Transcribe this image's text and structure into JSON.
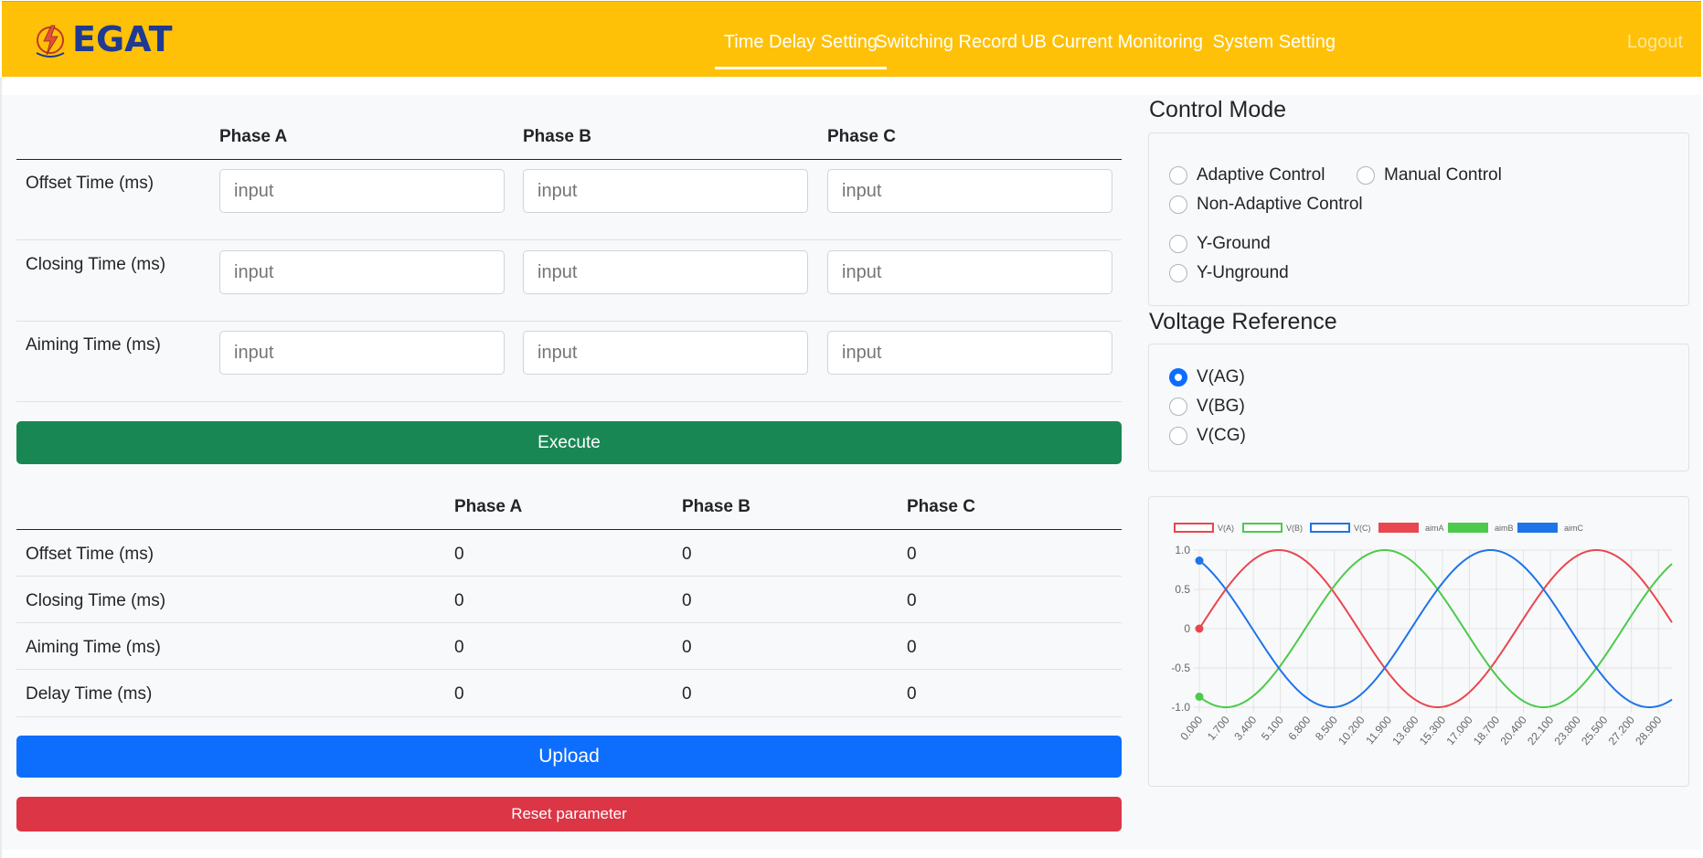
{
  "brand": {
    "name": "EGAT"
  },
  "nav": {
    "items": [
      {
        "label": "Time Delay Setting"
      },
      {
        "label": "Switching Record"
      },
      {
        "label": "UB Current Monitoring"
      },
      {
        "label": "System Setting"
      },
      {
        "label": "Logout"
      }
    ]
  },
  "settings_table": {
    "headers": [
      "Phase A",
      "Phase B",
      "Phase C"
    ],
    "rows": [
      {
        "label": "Offset Time (ms)",
        "placeholder": "input"
      },
      {
        "label": "Closing Time (ms)",
        "placeholder": "input"
      },
      {
        "label": "Aiming Time (ms)",
        "placeholder": "input"
      }
    ],
    "execute_label": "Execute"
  },
  "results_table": {
    "headers": [
      "Phase A",
      "Phase B",
      "Phase C"
    ],
    "rows": [
      {
        "label": "Offset Time (ms)",
        "values": [
          "0",
          "0",
          "0"
        ]
      },
      {
        "label": "Closing Time (ms)",
        "values": [
          "0",
          "0",
          "0"
        ]
      },
      {
        "label": "Aiming Time (ms)",
        "values": [
          "0",
          "0",
          "0"
        ]
      },
      {
        "label": "Delay Time (ms)",
        "values": [
          "0",
          "0",
          "0"
        ]
      }
    ],
    "upload_label": "Upload",
    "reset_label": "Reset parameter"
  },
  "control_mode": {
    "title": "Control Mode",
    "options": [
      {
        "label": "Adaptive Control",
        "checked": false
      },
      {
        "label": "Manual Control",
        "checked": false
      },
      {
        "label": "Non-Adaptive Control",
        "checked": false
      },
      {
        "label": "Y-Ground",
        "checked": false
      },
      {
        "label": "Y-Unground",
        "checked": false
      }
    ]
  },
  "voltage_reference": {
    "title": "Voltage Reference",
    "options": [
      {
        "label": "V(AG)",
        "checked": true
      },
      {
        "label": "V(BG)",
        "checked": false
      },
      {
        "label": "V(CG)",
        "checked": false
      }
    ]
  },
  "colors": {
    "navbar": "#ffc107",
    "success": "#198754",
    "primary": "#0d6efd",
    "danger": "#dc3545",
    "phaseA": "#e8474f",
    "phaseB": "#4cca4c",
    "phaseC": "#1f74e8"
  },
  "chart_data": {
    "type": "line",
    "legend": [
      "V(A)",
      "V(B)",
      "V(C)",
      "aimA",
      "aimB",
      "aimC"
    ],
    "legend_placement": "top",
    "x_ticks": [
      "0.000",
      "1.700",
      "3.400",
      "5.100",
      "6.800",
      "8.500",
      "10.200",
      "11.900",
      "13.600",
      "15.300",
      "17.000",
      "18.700",
      "20.400",
      "22.100",
      "23.800",
      "25.500",
      "27.200",
      "28.900"
    ],
    "y_ticks": [
      "1.0",
      "0.5",
      "0",
      "-0.5",
      "-1.0"
    ],
    "ylim": [
      -1,
      1
    ],
    "xlim": [
      0,
      29.75
    ],
    "grid": true,
    "series": [
      {
        "name": "V(A)",
        "color": "#e8474f",
        "function": "sin",
        "phase_deg": 0,
        "period_ms": 20
      },
      {
        "name": "V(B)",
        "color": "#4cca4c",
        "function": "sin",
        "phase_deg": -120,
        "period_ms": 20
      },
      {
        "name": "V(C)",
        "color": "#1f74e8",
        "function": "sin",
        "phase_deg": 120,
        "period_ms": 20
      }
    ],
    "aim_points": [
      {
        "name": "aimA",
        "color": "#e8474f",
        "x": 0,
        "y": 0
      },
      {
        "name": "aimB",
        "color": "#4cca4c",
        "x": 0,
        "y": -0.866
      },
      {
        "name": "aimC",
        "color": "#1f74e8",
        "x": 0,
        "y": 0.866
      }
    ]
  }
}
